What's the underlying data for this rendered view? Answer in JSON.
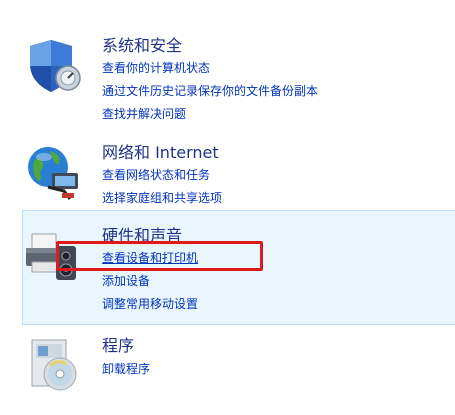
{
  "categories": [
    {
      "title": "系统和安全",
      "icon": "shield-icon",
      "links": [
        "查看你的计算机状态",
        "通过文件历史记录保存你的文件备份副本",
        "查找并解决问题"
      ]
    },
    {
      "title": "网络和 Internet",
      "icon": "globe-network-icon",
      "links": [
        "查看网络状态和任务",
        "选择家庭组和共享选项"
      ]
    },
    {
      "title": "硬件和声音",
      "icon": "printer-speaker-icon",
      "links": [
        "查看设备和打印机",
        "添加设备",
        "调整常用移动设置"
      ]
    },
    {
      "title": "程序",
      "icon": "programs-disc-icon",
      "links": [
        "卸载程序"
      ]
    }
  ],
  "colors": {
    "title": "#1e3287",
    "link": "#0033bc",
    "hover_bg": "#eaf6fd",
    "highlight": "#e0191e"
  }
}
